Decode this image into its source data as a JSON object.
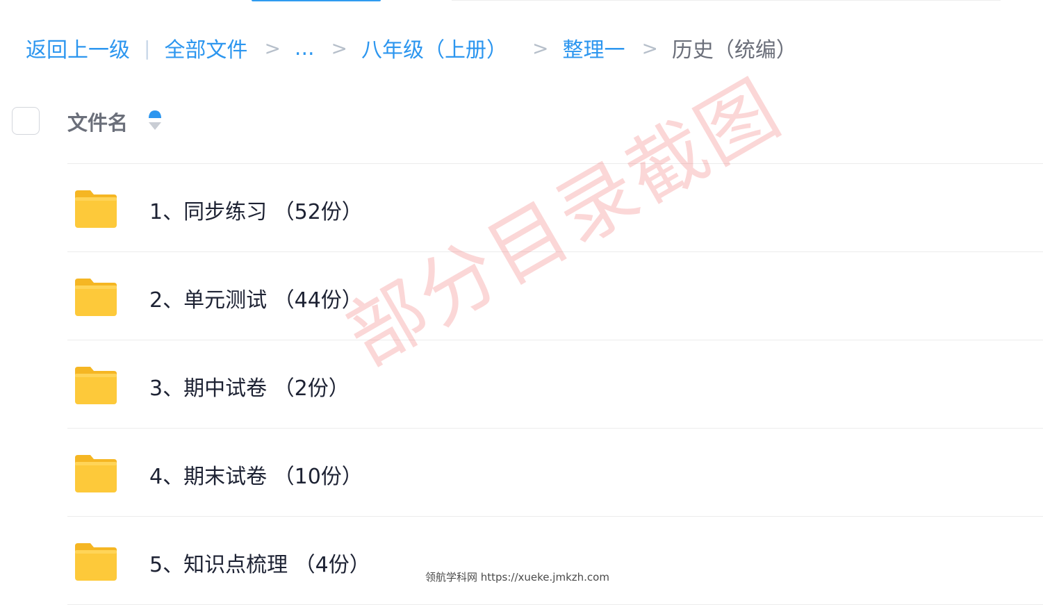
{
  "breadcrumb": {
    "back": "返回上一级",
    "pipe": "|",
    "sep": ">",
    "items": [
      "全部文件",
      "...",
      "八年级（上册）",
      "整理一",
      "历史（统编）"
    ]
  },
  "list_header": {
    "column_label": "文件名"
  },
  "files": [
    {
      "name": "1、同步练习 （52份）"
    },
    {
      "name": "2、单元测试 （44份）"
    },
    {
      "name": "3、期中试卷 （2份）"
    },
    {
      "name": "4、期末试卷 （10份）"
    },
    {
      "name": "5、知识点梳理 （4份）"
    }
  ],
  "watermark": "部分目录截图",
  "footer": "领航学科网 https://xueke.jmkzh.com",
  "colors": {
    "link": "#2c96ef",
    "current": "#6b6f7a",
    "folder": "#fdc93a",
    "watermark": "#f06e6e"
  },
  "icons": {
    "folder": "folder-icon",
    "sort": "sort-icon"
  }
}
